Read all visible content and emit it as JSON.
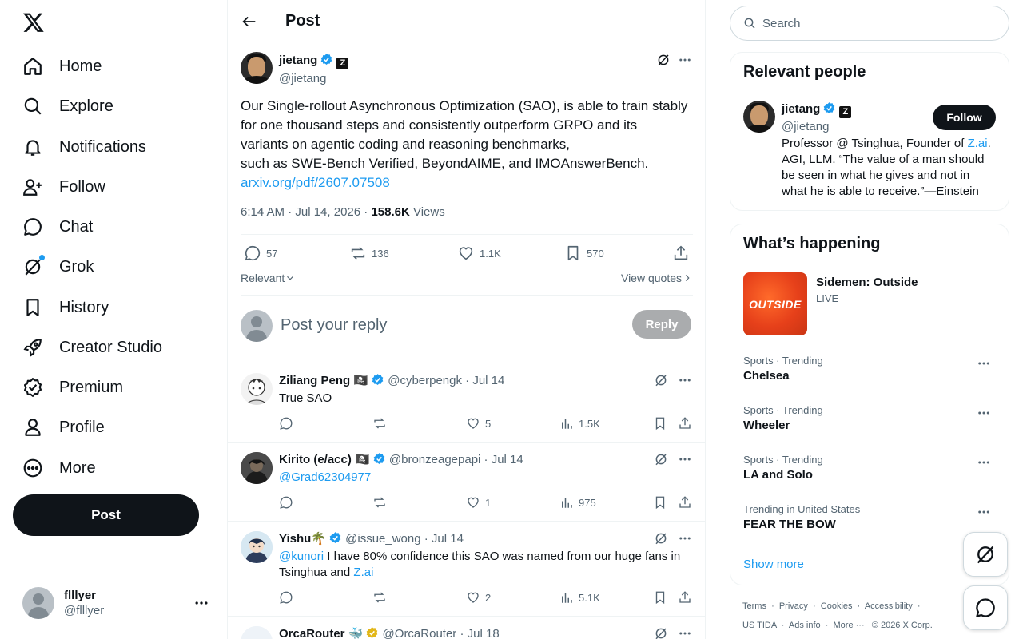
{
  "nav": {
    "items": [
      {
        "label": "Home",
        "icon": "home-icon"
      },
      {
        "label": "Explore",
        "icon": "search-icon"
      },
      {
        "label": "Notifications",
        "icon": "bell-icon"
      },
      {
        "label": "Follow",
        "icon": "person-plus-icon"
      },
      {
        "label": "Chat",
        "icon": "chat-bubble-icon"
      },
      {
        "label": "Grok",
        "icon": "grok-icon"
      },
      {
        "label": "History",
        "icon": "bookmark-icon"
      },
      {
        "label": "Creator Studio",
        "icon": "rocket-icon"
      },
      {
        "label": "Premium",
        "icon": "verified-badge-icon"
      },
      {
        "label": "Profile",
        "icon": "person-icon"
      },
      {
        "label": "More",
        "icon": "more-circle-icon"
      }
    ],
    "post_label": "Post"
  },
  "account": {
    "display_name": "flllyer",
    "handle": "@flllyer"
  },
  "header": {
    "title": "Post"
  },
  "post": {
    "author_name": "jietang",
    "author_handle": "@jietang",
    "text_lines": [
      "Our Single-rollout Asynchronous Optimization (SAO), is able to train stably for one thousand steps and consistently outperform GRPO and its variants on agentic coding and reasoning benchmarks,",
      "such as SWE-Bench Verified, BeyondAIME, and IMOAnswerBench."
    ],
    "link": "arxiv.org/pdf/2607.07508",
    "timestamp": "6:14 AM · Jul 14, 2026 · ",
    "views_count": "158.6K",
    "views_label": " Views",
    "replies": "57",
    "reposts": "136",
    "likes": "1.1K",
    "bookmarks": "570",
    "sort_label": "Relevant",
    "view_quotes": "View quotes"
  },
  "reply_box": {
    "placeholder": "Post your reply",
    "button": "Reply"
  },
  "replies": [
    {
      "name": "Ziliang Peng",
      "emoji": "🏴‍☠️",
      "handle": "@cyberpengk",
      "date": "· Jul 14",
      "text": "True SAO",
      "comments": "",
      "reposts": "",
      "likes": "5",
      "views": "1.5K"
    },
    {
      "name": "Kirito (e/acc)",
      "emoji": "🏴‍☠️",
      "handle": "@bronzeagepapi",
      "date": "· Jul 14",
      "mention": "@Grad62304977",
      "comments": "",
      "reposts": "",
      "likes": "1",
      "views": "975"
    },
    {
      "name": "Yishu🌴",
      "handle": "@issue_wong",
      "date": "· Jul 14",
      "mention": "@kunori",
      "text_a": " I have 80% confidence this SAO was named from our huge fans in Tsinghua and ",
      "link": "Z.ai",
      "comments": "",
      "reposts": "",
      "likes": "2",
      "views": "5.1K"
    },
    {
      "name": "OrcaRouter 🐳",
      "handle": "@OrcaRouter",
      "date": "· Jul 18"
    }
  ],
  "search": {
    "placeholder": "Search"
  },
  "relevant_people": {
    "title": "Relevant people",
    "name": "jietang",
    "handle": "@jietang",
    "follow": "Follow",
    "bio_a": "Professor @ Tsinghua, Founder of ",
    "bio_link": "Z.ai",
    "bio_b": ". AGI, LLM. “The value of a man should be seen in what he gives and not in what he is able to receive.”—Einstein"
  },
  "happening": {
    "title": "What’s happening",
    "featured": {
      "name": "Sidemen: Outside",
      "status": "LIVE",
      "image_text": "OUTSIDE"
    },
    "trends": [
      {
        "category": "Sports · Trending",
        "name": "Chelsea"
      },
      {
        "category": "Sports · Trending",
        "name": "Wheeler"
      },
      {
        "category": "Sports · Trending",
        "name": "LA and Solo"
      },
      {
        "category": "Trending in United States",
        "name": "FEAR THE BOW"
      }
    ],
    "show_more": "Show more"
  },
  "footer": {
    "row1": [
      "Terms",
      "Privacy",
      "Cookies",
      "Accessibility"
    ],
    "row2": [
      "US TIDA",
      "Ads info",
      "More ···",
      "© 2026 X Corp."
    ]
  },
  "colors": {
    "accent": "#1d9bf0",
    "text": "#0f1419",
    "secondary": "#536471"
  }
}
